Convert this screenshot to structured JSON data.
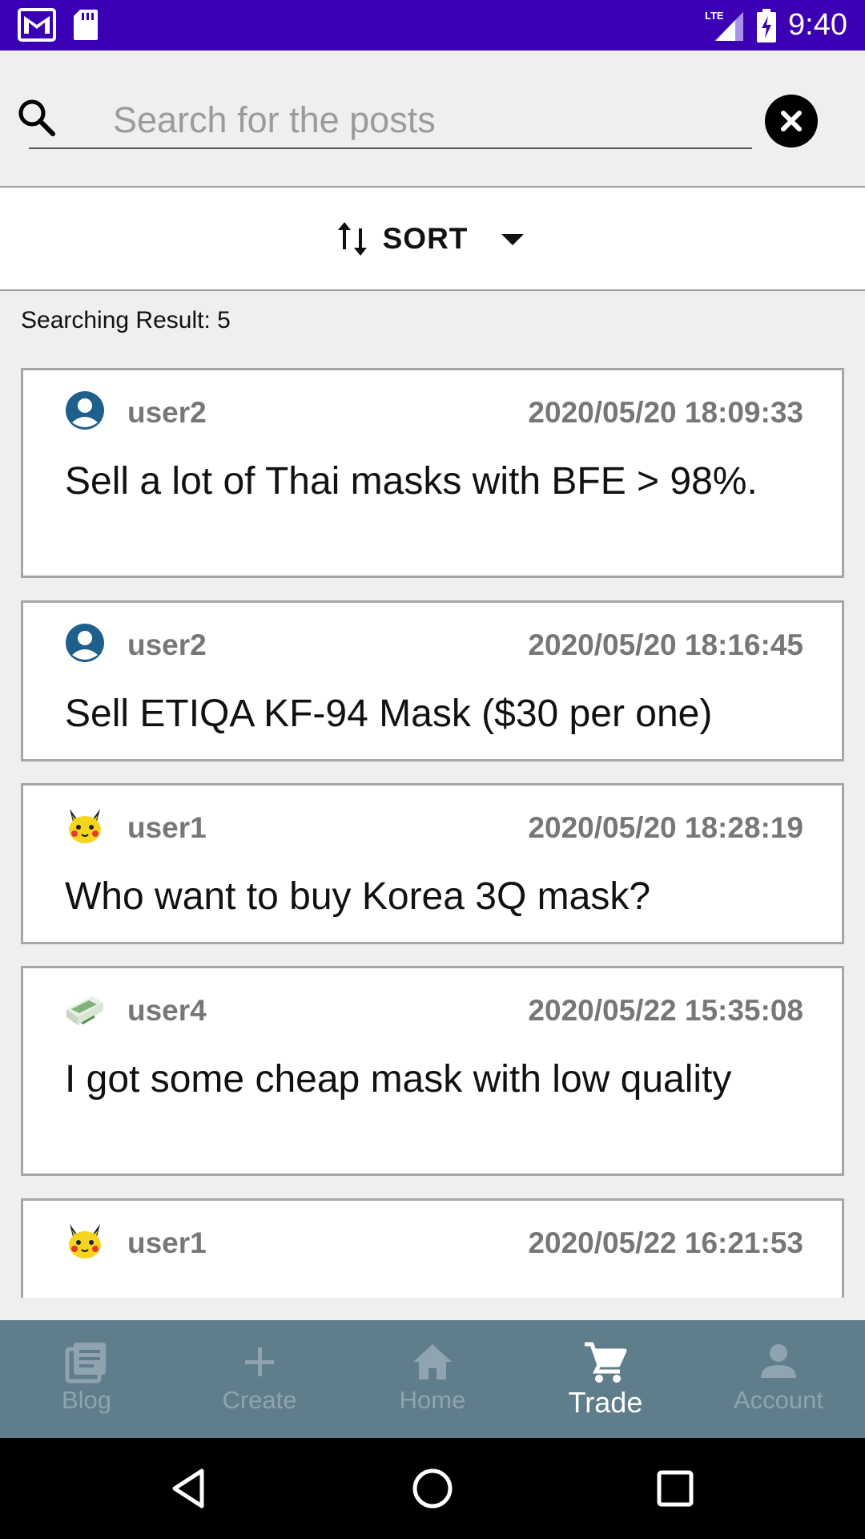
{
  "status_bar": {
    "time": "9:40",
    "network": "LTE"
  },
  "search": {
    "placeholder": "Search for the posts",
    "value": ""
  },
  "sort": {
    "label": "SORT"
  },
  "result_count": "Searching Result: 5",
  "posts": [
    {
      "user": "user2",
      "time": "2020/05/20 18:09:33",
      "text": "Sell a lot of Thai masks with BFE > 98%.",
      "avatar": "person-avatar-icon"
    },
    {
      "user": "user2",
      "time": "2020/05/20 18:16:45",
      "text": "Sell ETIQA KF-94 Mask ($30 per one)",
      "avatar": "person-avatar-icon"
    },
    {
      "user": "user1",
      "time": "2020/05/20 18:28:19",
      "text": "Who want to buy Korea 3Q mask?",
      "avatar": "pikachu-avatar"
    },
    {
      "user": "user4",
      "time": "2020/05/22 15:35:08",
      "text": "I got some cheap mask with low quality",
      "avatar": "mask-box-avatar"
    },
    {
      "user": "user1",
      "time": "2020/05/22 16:21:53",
      "text": "",
      "avatar": "pikachu-avatar"
    }
  ],
  "bottom_nav": [
    {
      "label": "Blog",
      "icon": "blog-icon",
      "active": false
    },
    {
      "label": "Create",
      "icon": "plus-icon",
      "active": false
    },
    {
      "label": "Home",
      "icon": "home-icon",
      "active": false
    },
    {
      "label": "Trade",
      "icon": "cart-icon",
      "active": true
    },
    {
      "label": "Account",
      "icon": "account-icon",
      "active": false
    }
  ],
  "colors": {
    "status_bar": "#3b00b3",
    "bottom_nav": "#607d8b",
    "card_border": "#a6a6a6",
    "meta_text": "#777777"
  }
}
